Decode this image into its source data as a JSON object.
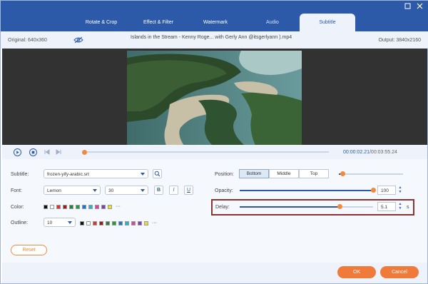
{
  "tabs": [
    {
      "label": "Rotate & Crop"
    },
    {
      "label": "Effect & Filter"
    },
    {
      "label": "Watermark"
    },
    {
      "label": "Audio"
    },
    {
      "label": "Subtitle",
      "active": true
    }
  ],
  "window": {
    "restore_icon": "restore-icon",
    "close_icon": "close-icon"
  },
  "info": {
    "original": "Original: 640x360",
    "file_name": "Islands in the Stream - Kenny Roge... with Gerly Ann @itsgerlyann ).mp4",
    "output": "Output: 3840x2160"
  },
  "player": {
    "current_time": "00:00:02.21",
    "total_time": "/00:03:55.24",
    "progress": 0.005
  },
  "subtitle": {
    "label": "Subtitle:",
    "file": "frozen-yify-arabic.srt"
  },
  "font": {
    "label": "Font:",
    "name": "Lemon",
    "size": "30",
    "bold": "B",
    "italic": "I",
    "underline": "U"
  },
  "color": {
    "label": "Color:",
    "swatches": [
      "#111111",
      "#ffffff",
      "#e03030",
      "#9b1b1b",
      "#2e7d32",
      "#1e9e3a",
      "#1976d2",
      "#20b8c8",
      "#e040a0",
      "#7b3fb8",
      "#e8e030"
    ],
    "more": "···"
  },
  "outline": {
    "label": "Outline:",
    "width": "10",
    "swatches": [
      "#111111",
      "#ffffff",
      "#e03030",
      "#9b1b1b",
      "#2e7d32",
      "#1e9e3a",
      "#1976d2",
      "#20b8c8",
      "#e040a0",
      "#7b3fb8",
      "#e8e030"
    ],
    "more": "···"
  },
  "position": {
    "label": "Position:",
    "options": [
      "Bottom",
      "Middle",
      "Top"
    ],
    "selected": "Bottom",
    "slider_level": 0.05
  },
  "opacity": {
    "label": "Opacity:",
    "value": "100",
    "level": 1.0
  },
  "delay": {
    "label": "Delay:",
    "value": "5.1",
    "unit": "s",
    "level": 0.75
  },
  "buttons": {
    "reset": "Reset",
    "ok": "OK",
    "cancel": "Cancel"
  },
  "colors": {
    "accent": "#2d5aa8",
    "orange": "#f07a3a",
    "highlight_border": "#8b3333"
  }
}
